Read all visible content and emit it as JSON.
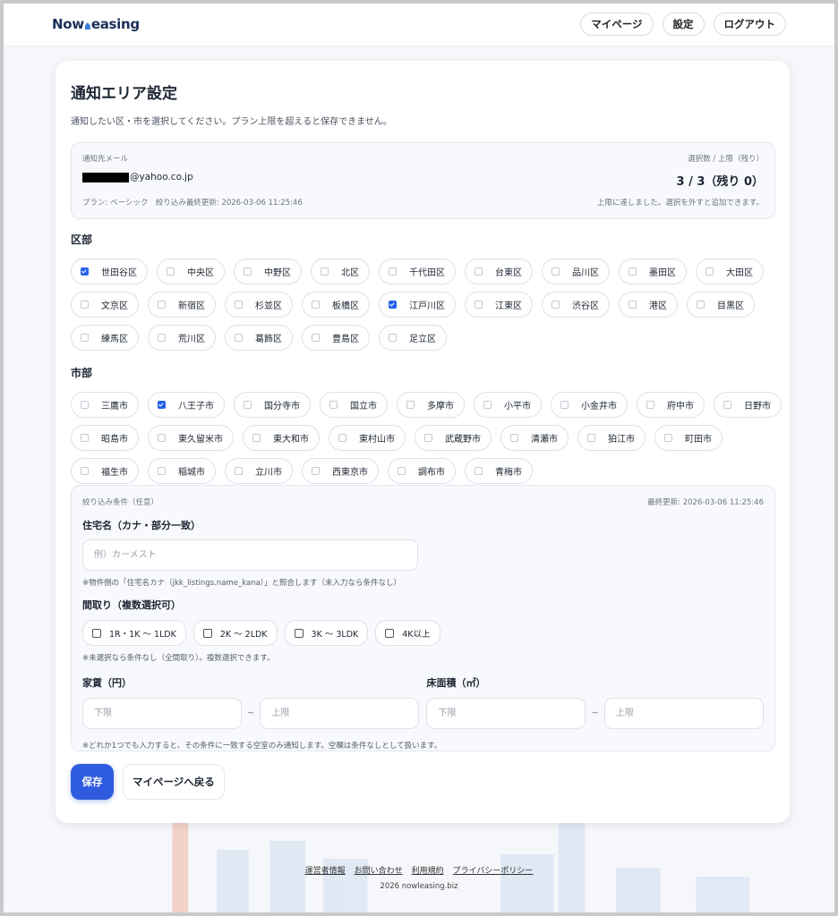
{
  "header": {
    "logo": {
      "part1": "Now",
      "part2": "easing",
      "part3": "L"
    },
    "nav": [
      "マイページ",
      "設定",
      "ログアウト"
    ]
  },
  "page": {
    "title": "通知エリア設定",
    "subtitle": "通知したい区・市を選択してください。プラン上限を超えると保存できません。"
  },
  "info": {
    "email_label": "通知先メール",
    "email_domain": "@yahoo.co.jp",
    "plan_text": "プラン: ベーシック　絞り込み最終更新: 2026-03-06 11:25:46",
    "counter_label": "選択数 / 上限（残り）",
    "counter_value": "3 / 3（残り 0）",
    "limit_note": "上限に達しました。選択を外すと追加できます。"
  },
  "wards": {
    "heading": "区部",
    "items": [
      {
        "label": "世田谷区",
        "checked": true
      },
      {
        "label": "中央区",
        "checked": false
      },
      {
        "label": "中野区",
        "checked": false
      },
      {
        "label": "北区",
        "checked": false
      },
      {
        "label": "千代田区",
        "checked": false
      },
      {
        "label": "台東区",
        "checked": false
      },
      {
        "label": "品川区",
        "checked": false
      },
      {
        "label": "墨田区",
        "checked": false
      },
      {
        "label": "大田区",
        "checked": false
      },
      {
        "label": "文京区",
        "checked": false
      },
      {
        "label": "新宿区",
        "checked": false
      },
      {
        "label": "杉並区",
        "checked": false
      },
      {
        "label": "板橋区",
        "checked": false
      },
      {
        "label": "江戸川区",
        "checked": true
      },
      {
        "label": "江東区",
        "checked": false
      },
      {
        "label": "渋谷区",
        "checked": false
      },
      {
        "label": "港区",
        "checked": false
      },
      {
        "label": "目黒区",
        "checked": false
      },
      {
        "label": "練馬区",
        "checked": false
      },
      {
        "label": "荒川区",
        "checked": false
      },
      {
        "label": "葛飾区",
        "checked": false
      },
      {
        "label": "豊島区",
        "checked": false
      },
      {
        "label": "足立区",
        "checked": false
      }
    ]
  },
  "cities": {
    "heading": "市部",
    "items": [
      {
        "label": "三鷹市",
        "checked": false
      },
      {
        "label": "八王子市",
        "checked": true
      },
      {
        "label": "国分寺市",
        "checked": false
      },
      {
        "label": "国立市",
        "checked": false
      },
      {
        "label": "多摩市",
        "checked": false
      },
      {
        "label": "小平市",
        "checked": false
      },
      {
        "label": "小金井市",
        "checked": false
      },
      {
        "label": "府中市",
        "checked": false
      },
      {
        "label": "日野市",
        "checked": false
      },
      {
        "label": "昭島市",
        "checked": false
      },
      {
        "label": "東久留米市",
        "checked": false
      },
      {
        "label": "東大和市",
        "checked": false
      },
      {
        "label": "東村山市",
        "checked": false
      },
      {
        "label": "武蔵野市",
        "checked": false
      },
      {
        "label": "清瀬市",
        "checked": false
      },
      {
        "label": "狛江市",
        "checked": false
      },
      {
        "label": "町田市",
        "checked": false
      },
      {
        "label": "福生市",
        "checked": false
      },
      {
        "label": "稲城市",
        "checked": false
      },
      {
        "label": "立川市",
        "checked": false
      },
      {
        "label": "西東京市",
        "checked": false
      },
      {
        "label": "調布市",
        "checked": false
      },
      {
        "label": "青梅市",
        "checked": false
      }
    ]
  },
  "filters": {
    "title": "絞り込み条件（任意）",
    "updated": "最終更新: 2026-03-06 11:25:46",
    "name_label": "住宅名（カナ・部分一致）",
    "name_placeholder": "例）カーメスト",
    "name_note": "※物件側の「住宅名カナ（jkk_listings.name_kana）」と照合します（未入力なら条件なし）",
    "layout_label": "間取り（複数選択可）",
    "layouts": [
      "1R・1K ～ 1LDK",
      "2K ～ 2LDK",
      "3K ～ 3LDK",
      "4K以上"
    ],
    "layout_note": "※未選択なら条件なし（全間取り）。複数選択できます。",
    "rent_label": "家賃（円）",
    "area_label": "床面積（㎡）",
    "min_placeholder": "下限",
    "max_placeholder": "上限",
    "tilde": "~",
    "bottom_note": "※どれか1つでも入力すると、その条件に一致する空室のみ通知します。空欄は条件なしとして扱います。"
  },
  "actions": {
    "save": "保存",
    "back": "マイページへ戻る"
  },
  "footer": {
    "links": [
      "運営者情報",
      "お問い合わせ",
      "利用規約",
      "プライバシーポリシー"
    ],
    "copyright": "2026 nowleasing.biz"
  },
  "colors": {
    "primary": "#2f5bde",
    "checkbox": "#2563eb"
  }
}
